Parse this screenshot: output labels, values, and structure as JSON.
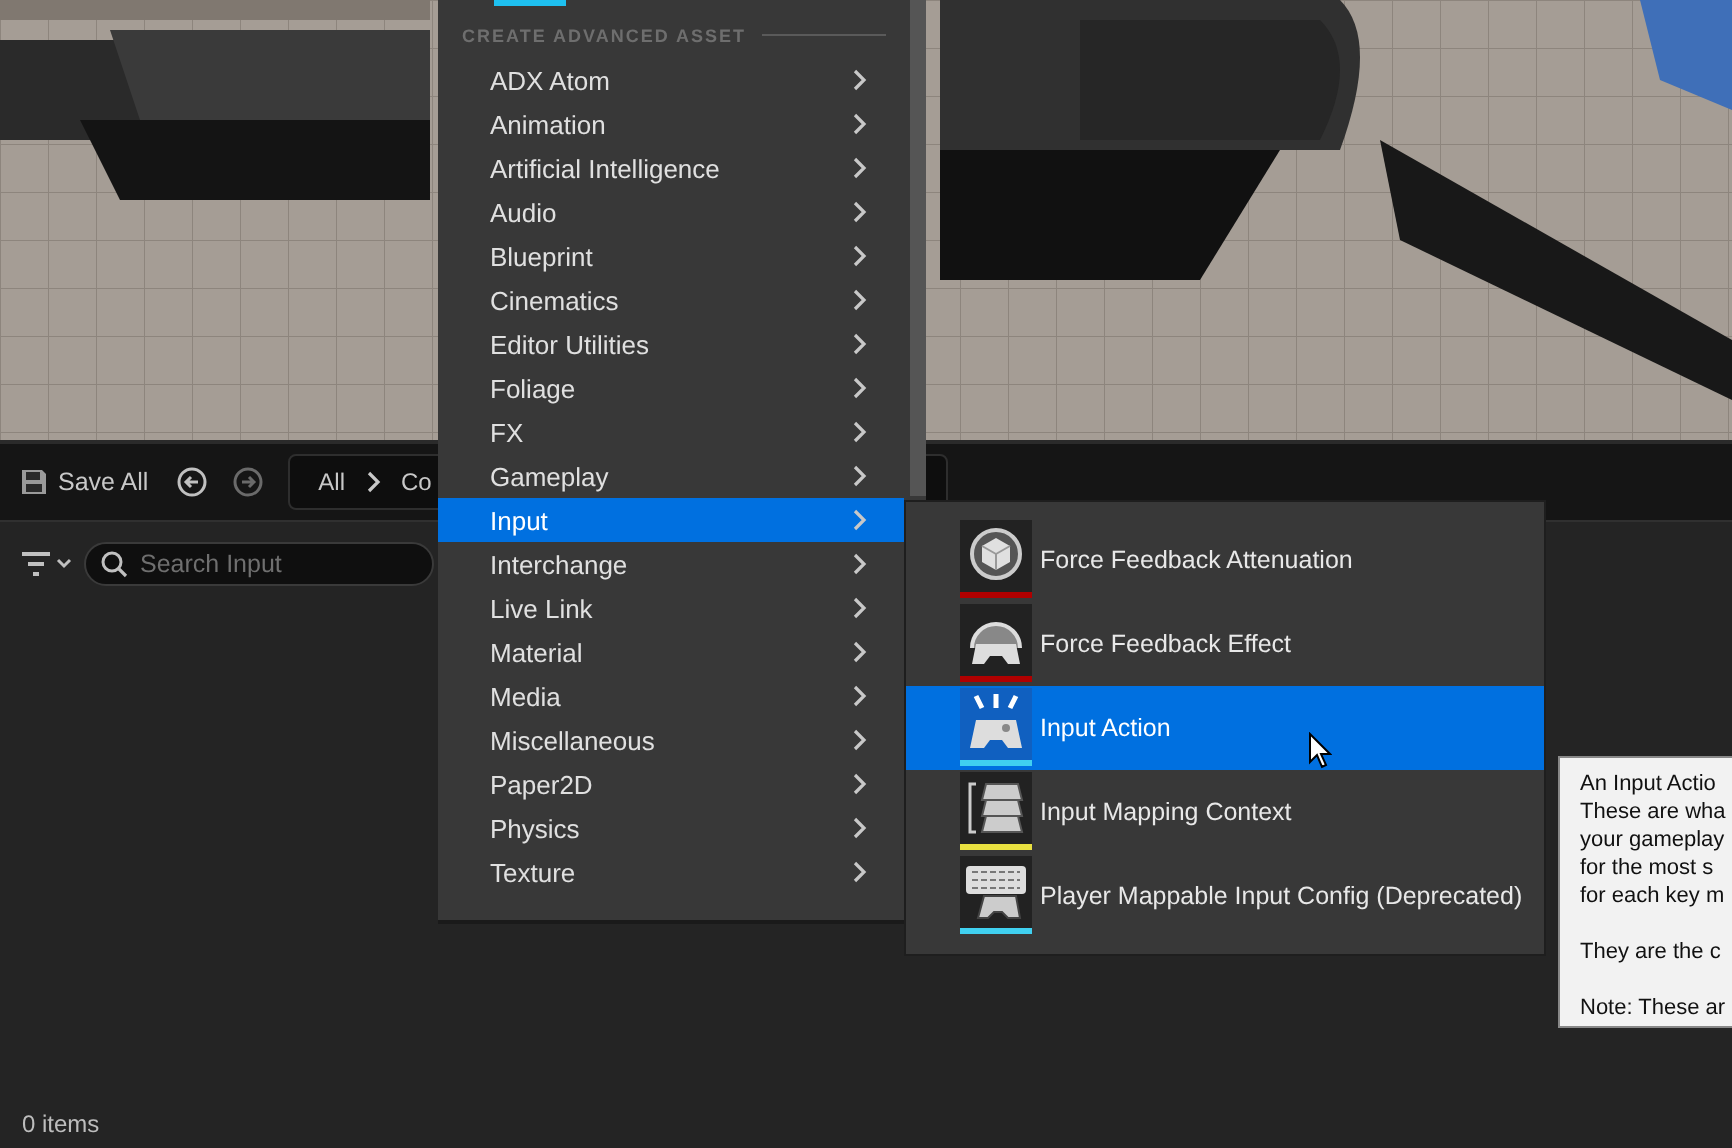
{
  "toolbar": {
    "save_all": "Save All",
    "breadcrumb": [
      "All",
      "Co"
    ]
  },
  "search": {
    "placeholder": "Search Input"
  },
  "status_bar": "0 items",
  "menu": {
    "header": "CREATE ADVANCED ASSET",
    "items": [
      {
        "label": "ADX Atom",
        "selected": false
      },
      {
        "label": "Animation",
        "selected": false
      },
      {
        "label": "Artificial Intelligence",
        "selected": false
      },
      {
        "label": "Audio",
        "selected": false
      },
      {
        "label": "Blueprint",
        "selected": false
      },
      {
        "label": "Cinematics",
        "selected": false
      },
      {
        "label": "Editor Utilities",
        "selected": false
      },
      {
        "label": "Foliage",
        "selected": false
      },
      {
        "label": "FX",
        "selected": false
      },
      {
        "label": "Gameplay",
        "selected": false
      },
      {
        "label": "Input",
        "selected": true
      },
      {
        "label": "Interchange",
        "selected": false
      },
      {
        "label": "Live Link",
        "selected": false
      },
      {
        "label": "Material",
        "selected": false
      },
      {
        "label": "Media",
        "selected": false
      },
      {
        "label": "Miscellaneous",
        "selected": false
      },
      {
        "label": "Paper2D",
        "selected": false
      },
      {
        "label": "Physics",
        "selected": false
      },
      {
        "label": "Texture",
        "selected": false
      }
    ]
  },
  "submenu": {
    "items": [
      {
        "label": "Force Feedback Attenuation",
        "selected": false,
        "color": "#b00000"
      },
      {
        "label": "Force Feedback Effect",
        "selected": false,
        "color": "#b00000"
      },
      {
        "label": "Input Action",
        "selected": true,
        "color": "#40d0f0"
      },
      {
        "label": "Input Mapping Context",
        "selected": false,
        "color": "#e8e040"
      },
      {
        "label": "Player Mappable Input Config (Deprecated)",
        "selected": false,
        "color": "#40d0f0"
      }
    ]
  },
  "tooltip": {
    "paragraphs": [
      [
        "An Input Actio",
        "These are wha",
        "your gameplay",
        "for the most s",
        "for each key m"
      ],
      [
        "They are the c"
      ],
      [
        "Note: These ar"
      ]
    ]
  }
}
